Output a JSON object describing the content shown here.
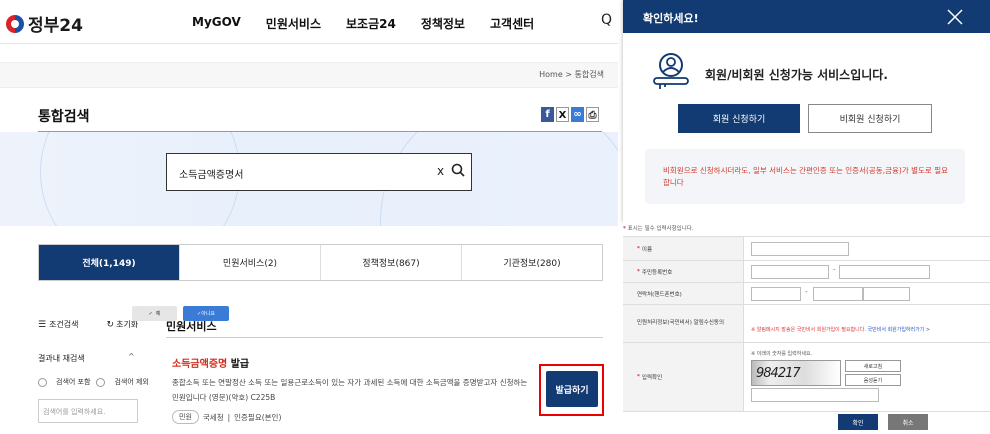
{
  "site": {
    "logo_text": "정부24"
  },
  "nav": {
    "items": [
      "MyGOV",
      "민원서비스",
      "보조금24",
      "정책정보",
      "고객센터"
    ]
  },
  "breadcrumb": "Home > 통합검색",
  "page_title": "통합검색",
  "share_icons": [
    "facebook-icon",
    "x-icon",
    "link-icon",
    "print-icon"
  ],
  "search": {
    "value": "소득금액증명서",
    "clear": "x"
  },
  "tabs": [
    "전체(1,149)",
    "민원서비스(2)",
    "정책정보(867)",
    "기관정보(280)"
  ],
  "filter": {
    "condition_label": "조건검색",
    "reset_label": "초기화",
    "within_label": "결과내 재검색",
    "include_label": "검색어 포함",
    "exclude_label": "검색어 제외",
    "input_placeholder": "검색어를 입력하세요."
  },
  "section": {
    "title": "민원서비스"
  },
  "result": {
    "title_hl_1": "소득금액",
    "title_hl_2": "증명",
    "title_rest": " 발급",
    "desc": "종합소득 또는 연말정산 소득 또는 일용근로소득이 있는 자가 과세된 소득에 대한 소득금액을 증명받고자 신청하는 민원입니다 (영문)(약호) C225B",
    "badge": "민원",
    "agency": "국세청",
    "auth": "인증필요(본인)",
    "issue_button": "발급하기"
  },
  "modal": {
    "title": "확인하세요!",
    "message": "회원/비회원 신청가능 서비스입니다.",
    "member_button": "회원 신청하기",
    "nonmember_button": "비회원 신청하기",
    "notice": "비회원으로 신청하시더라도, 일부 서비스는 간편인증 또는 인증서(공동,금융)가 별도로 필요합니다"
  },
  "form": {
    "required_note": "표시는 필수 입력사항입니다.",
    "labels": {
      "name": "이름",
      "rrn": "주민등록번호",
      "phone": "연락처(핸드폰번호)",
      "agree": "민원처리정보(국민비서) 알림수신동의",
      "captcha": "입력확인"
    },
    "yes": "예",
    "no": "아니요",
    "warn": "※ 알림메시지 발송은 국민비서 회원가입이 필요합니다.",
    "warn_link": "국민비서 회원가입하러가기 >",
    "captcha_note": "※ 이래의 숫자를 입력하세요.",
    "captcha_value": "984217",
    "refresh": "새로고침",
    "audio": "음성듣기",
    "confirm": "확인",
    "cancel": "취소"
  },
  "colors": {
    "primary": "#123a73",
    "accent_red": "#d03020",
    "highlight_frame": "#e00000"
  }
}
